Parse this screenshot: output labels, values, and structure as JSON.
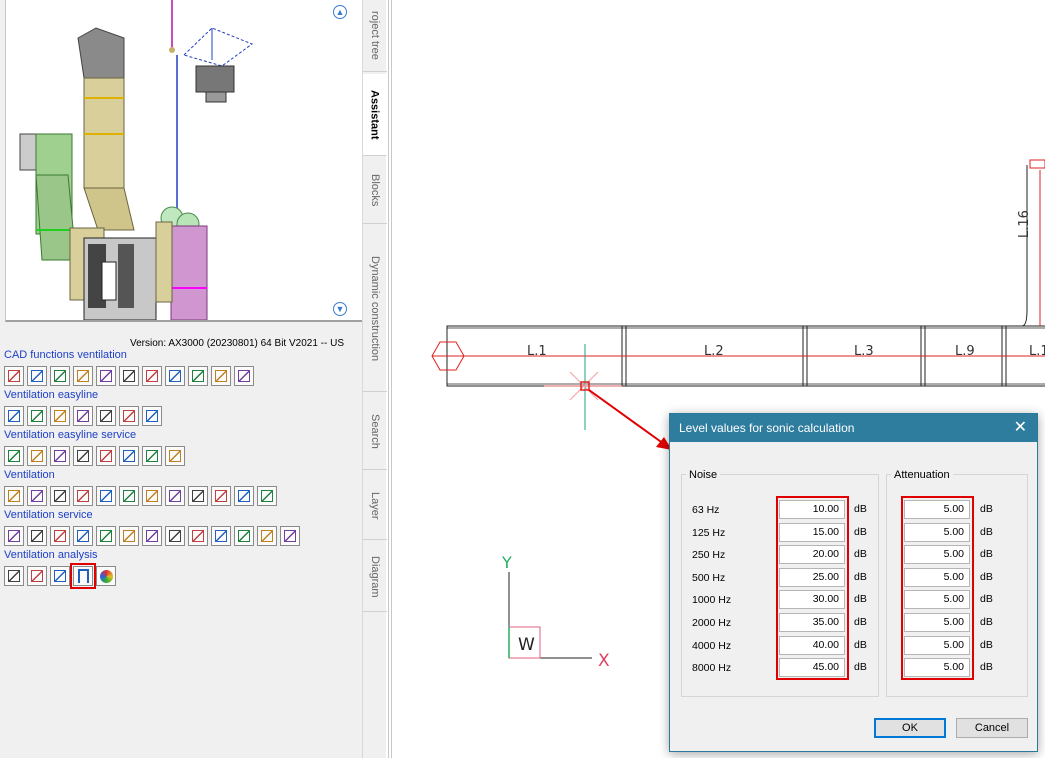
{
  "left_panel": {
    "version": "Version: AX3000 (20230801) 64 Bit V2021  -- US",
    "sections": [
      {
        "title": "CAD functions ventilation",
        "count": 11
      },
      {
        "title": "Ventilation easyline",
        "count": 7
      },
      {
        "title": "Ventilation easyline service",
        "count": 8
      },
      {
        "title": "Ventilation",
        "count": 12
      },
      {
        "title": "Ventilation service",
        "count": 13
      },
      {
        "title": "Ventilation analysis",
        "count": 5
      }
    ],
    "highlighted_tool": "sonic-calculation-icon"
  },
  "vertical_tabs": [
    "roject tree",
    "Assistant",
    "Blocks",
    "Dynamic construction",
    "Search",
    "Layer",
    "Diagram"
  ],
  "active_tab": "Assistant",
  "drawing": {
    "duct_labels": [
      "L.1",
      "L.2",
      "L.3",
      "L.9",
      "L.1",
      "L.16"
    ],
    "axis_y": "Y",
    "axis_x": "X",
    "ucs": "W"
  },
  "dialog": {
    "title": "Level values for sonic calculation",
    "noise_label": "Noise",
    "attenuation_label": "Attenuation",
    "unit": "dB",
    "rows": [
      {
        "hz": "63 Hz",
        "noise": "10.00",
        "attenuation": "5.00"
      },
      {
        "hz": "125 Hz",
        "noise": "15.00",
        "attenuation": "5.00"
      },
      {
        "hz": "250 Hz",
        "noise": "20.00",
        "attenuation": "5.00"
      },
      {
        "hz": "500 Hz",
        "noise": "25.00",
        "attenuation": "5.00"
      },
      {
        "hz": "1000 Hz",
        "noise": "30.00",
        "attenuation": "5.00"
      },
      {
        "hz": "2000 Hz",
        "noise": "35.00",
        "attenuation": "5.00"
      },
      {
        "hz": "4000 Hz",
        "noise": "40.00",
        "attenuation": "5.00"
      },
      {
        "hz": "8000 Hz",
        "noise": "45.00",
        "attenuation": "5.00"
      }
    ],
    "ok_label": "OK",
    "cancel_label": "Cancel"
  },
  "colors": {
    "dialog_title_bar": "#2f7d9e",
    "section_title": "#1c3fc8",
    "highlight_red": "#e00000",
    "cad_red_line": "#e02020",
    "ok_border": "#0078d7"
  }
}
